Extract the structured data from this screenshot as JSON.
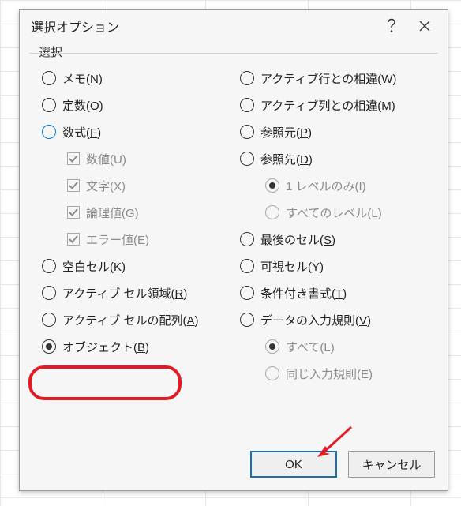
{
  "dialog": {
    "title": "選択オプション",
    "group_label": "選択",
    "left": [
      {
        "key": "memo",
        "label": "メモ",
        "akey": "N",
        "type": "radio",
        "checked": false
      },
      {
        "key": "const",
        "label": "定数",
        "akey": "O",
        "type": "radio",
        "checked": false
      },
      {
        "key": "formula",
        "label": "数式",
        "akey": "F",
        "type": "radio",
        "checked": false,
        "accent": true
      },
      {
        "key": "num",
        "label": "数値",
        "akey_plain": "U",
        "type": "check",
        "checked": true,
        "disabled": true,
        "sub": true
      },
      {
        "key": "text",
        "label": "文字",
        "akey_plain": "X",
        "type": "check",
        "checked": true,
        "disabled": true,
        "sub": true
      },
      {
        "key": "logic",
        "label": "論理値",
        "akey_plain": "G",
        "type": "check",
        "checked": true,
        "disabled": true,
        "sub": true
      },
      {
        "key": "err",
        "label": "エラー値",
        "akey_plain": "E",
        "type": "check",
        "checked": true,
        "disabled": true,
        "sub": true
      },
      {
        "key": "blank",
        "label": "空白セル",
        "akey": "K",
        "type": "radio",
        "checked": false
      },
      {
        "key": "region",
        "label": "アクティブ セル領域",
        "akey": "R",
        "type": "radio",
        "checked": false
      },
      {
        "key": "array",
        "label": "アクティブ セルの配列",
        "akey": "A",
        "type": "radio",
        "checked": false
      },
      {
        "key": "object",
        "label": "オブジェクト",
        "akey": "B",
        "type": "radio",
        "checked": true
      }
    ],
    "right": [
      {
        "key": "rowdiff",
        "label": "アクティブ行との相違",
        "akey": "W",
        "type": "radio",
        "checked": false
      },
      {
        "key": "coldiff",
        "label": "アクティブ列との相違",
        "akey": "M",
        "type": "radio",
        "checked": false
      },
      {
        "key": "prec",
        "label": "参照元",
        "akey": "P",
        "type": "radio",
        "checked": false
      },
      {
        "key": "dep",
        "label": "参照先",
        "akey": "D",
        "type": "radio",
        "checked": false
      },
      {
        "key": "lvl1",
        "label": "1 レベルのみ",
        "akey_plain": "I",
        "type": "radio",
        "checked": true,
        "disabled": true,
        "sub": true
      },
      {
        "key": "lvla",
        "label": "すべてのレベル",
        "akey_plain": "L",
        "type": "radio",
        "checked": false,
        "disabled": true,
        "sub": true
      },
      {
        "key": "last",
        "label": "最後のセル",
        "akey": "S",
        "type": "radio",
        "checked": false
      },
      {
        "key": "vis",
        "label": "可視セル",
        "akey": "Y",
        "type": "radio",
        "checked": false
      },
      {
        "key": "cond",
        "label": "条件付き書式",
        "akey": "T",
        "type": "radio",
        "checked": false
      },
      {
        "key": "valid",
        "label": "データの入力規則",
        "akey": "V",
        "type": "radio",
        "checked": false
      },
      {
        "key": "all",
        "label": "すべて",
        "akey_plain": "L",
        "type": "radio",
        "checked": true,
        "disabled": true,
        "sub": true
      },
      {
        "key": "same",
        "label": "同じ入力規則",
        "akey_plain": "E",
        "type": "radio",
        "checked": false,
        "disabled": true,
        "sub": true
      }
    ],
    "buttons": {
      "ok": "OK",
      "cancel": "キャンセル"
    }
  }
}
